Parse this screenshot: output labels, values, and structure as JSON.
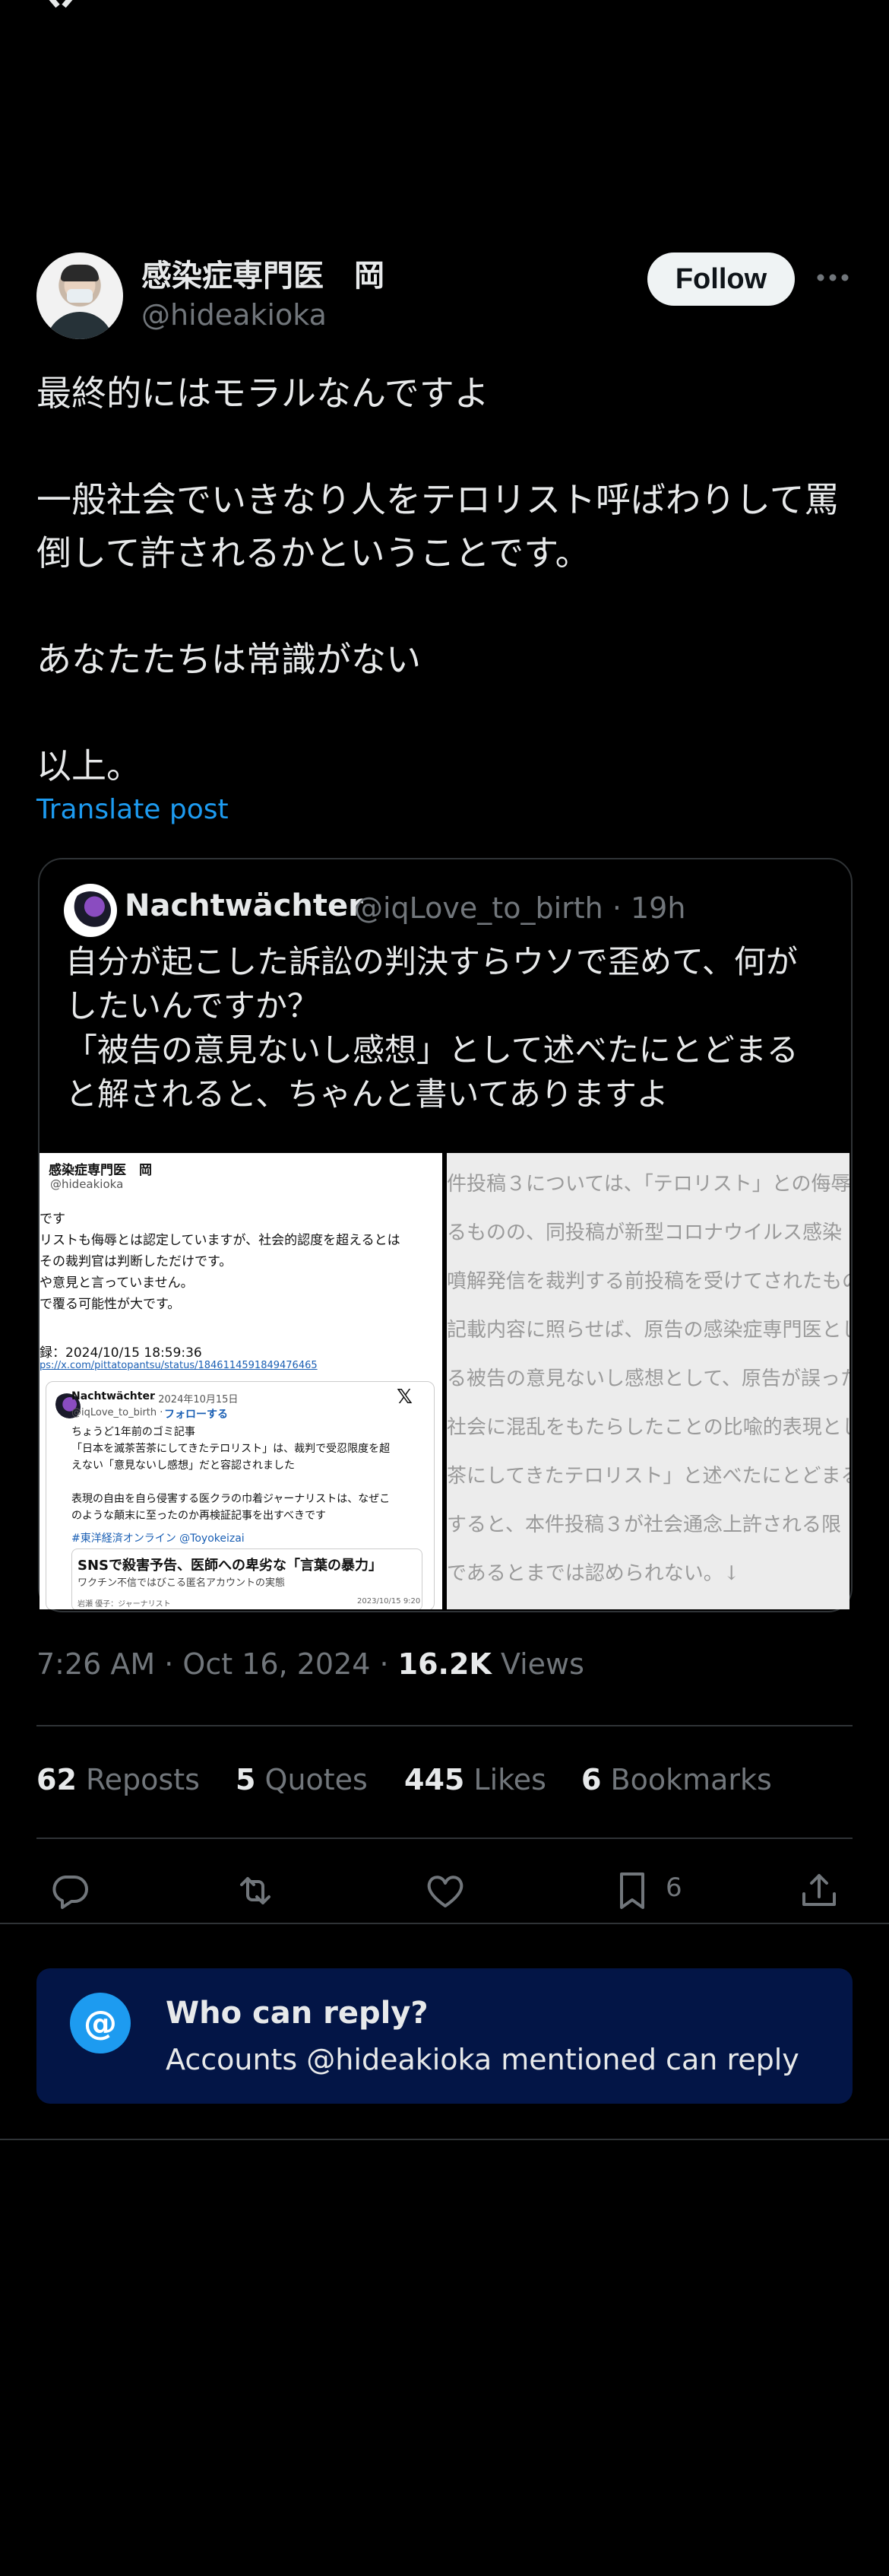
{
  "post": {
    "author_name": "感染症専門医　岡",
    "author_handle": "@hideakioka",
    "follow_label": "Follow",
    "more_icon": "more-horizontal-icon",
    "body": "最終的にはモラルなんですよ\n\n一般社会でいきなり人をテロリスト呼ばわりして罵倒して許されるかということです。\n\nあなたたちは常識がない\n\n以上。",
    "translate_label": "Translate post",
    "timestamp": "7:26 AM · Oct 16, 2024 · ",
    "views_count": "16.2K",
    "views_label": " Views"
  },
  "quote": {
    "name": "Nachtwächter",
    "handle": "@iqLove_to_birth",
    "time": " · 19h",
    "text": "自分が起こした訴訟の判決すらウソで歪めて、何がしたいんですか？\n「被告の意見ないし感想」として述べたにとどまると解されると、ちゃんと書いてありますよ",
    "image1": {
      "header_name": "感染症専門医　岡",
      "header_handle": "@hideakioka",
      "lines": [
        "です",
        "リストも侮辱とは認定していますが、社会的認度を超えるとは",
        "その裁判官は判断しただけです。",
        "や意見と言っていません。",
        "で覆る可能性が大です。"
      ],
      "record": "録：2024/10/15 18:59:36",
      "link": "ps://x.com/pittatopantsu/status/1846114591849476465",
      "embed_name": "Nachtwächter",
      "embed_date": "· 2024年10月15日",
      "embed_handle": "@iqLove_to_birth ·",
      "embed_follow": "フォローする",
      "embed_lines": [
        "ちょうど1年前のゴミ記事",
        "「日本を滅茶苦茶にしてきたテロリスト」は、裁判で受忍限度を超",
        "えない「意見ないし感想」だと容認されました",
        "",
        "表現の自由を自ら侵害する医クラの巾着ジャーナリストは、なぜこ",
        "のような顛末に至ったのか再検証記事を出すべきです"
      ],
      "embed_tag": "#東洋経済オンライン @Toyokeizai",
      "card_title": "SNSで殺害予告、医師への卑劣な「言葉の暴力」",
      "card_sub": "ワクチン不信ではびこる匿名アカウントの実態",
      "card_author": "岩瀬 優子：ジャーナリスト",
      "card_date": "2023/10/15 9:20"
    },
    "image2": {
      "lines": [
        "件投稿３については、「テロリスト」との侮辱",
        "るものの、同投稿が新型コロナウイルス感染",
        "噴解発信を裁判する前投稿を受けてされたもの",
        "記載内容に照らせば、原告の感染症専門医とし",
        "る被告の意見ないし感想として、原告が誤った",
        "社会に混乱をもたらしたことの比喩的表現とし",
        "茶にしてきたテロリスト」と述べたにとどまる",
        "すると、本件投稿３が社会通念上許される限",
        "であるとまでは認められない。↓"
      ]
    }
  },
  "stats": {
    "reposts_count": "62",
    "reposts_label": " Reposts",
    "quotes_count": "5",
    "quotes_label": " Quotes",
    "likes_count": "445",
    "likes_label": " Likes",
    "bookmarks_count": "6",
    "bookmarks_label": " Bookmarks"
  },
  "actions": {
    "reply_icon": "reply-icon",
    "repost_icon": "repost-icon",
    "like_icon": "heart-icon",
    "bookmark_icon": "bookmark-icon",
    "bookmark_count": "6",
    "share_icon": "share-icon"
  },
  "reply_settings": {
    "icon_text": "@",
    "title": "Who can reply?",
    "subtitle": "Accounts @hideakioka mentioned can reply"
  },
  "colors": {
    "accent": "#1d9bf0",
    "background": "#000000",
    "muted": "#71767b",
    "divider": "#2f3336",
    "reply_bg": "#031546"
  }
}
